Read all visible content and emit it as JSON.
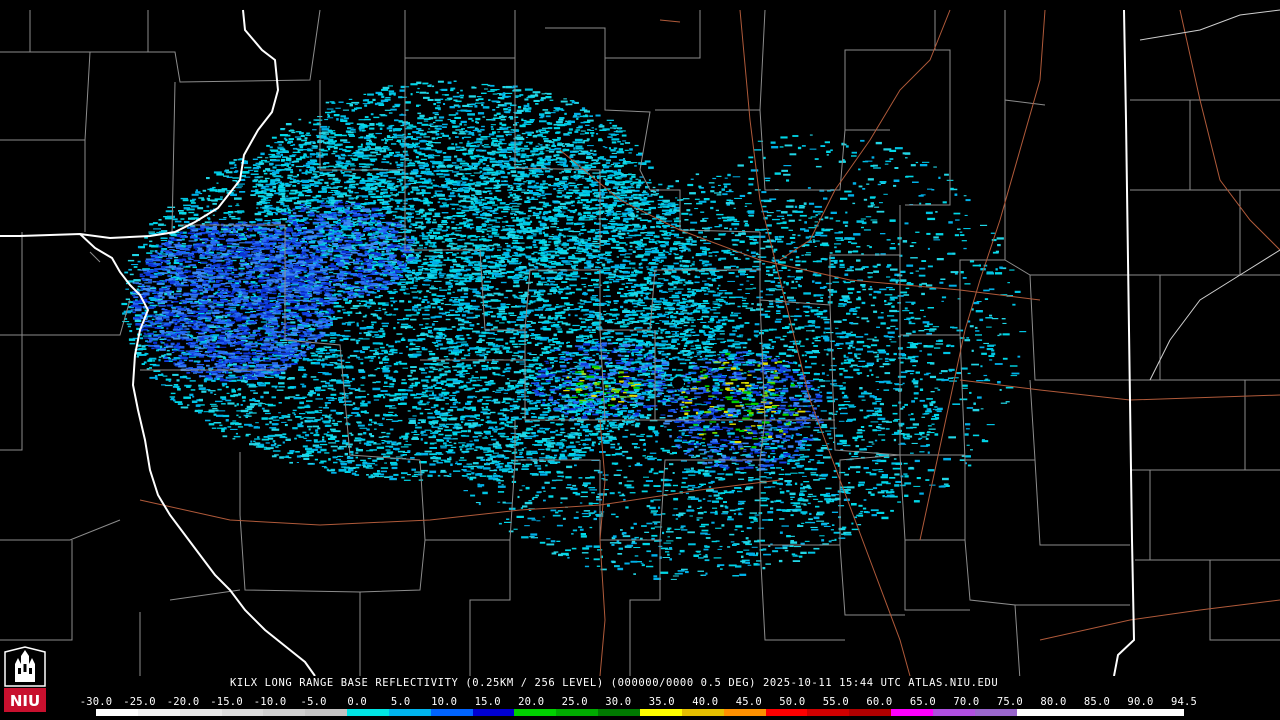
{
  "map": {
    "caption": "KILX LONG RANGE BASE REFLECTIVITY (0.25KM / 256 LEVEL) (000000/0000 0.5 DEG) 2025-10-11 15:44 UTC  ATLAS.NIU.EDU",
    "logo_text": "NIU",
    "colors": {
      "background": "#000000",
      "county_lines": "#8c8c8c",
      "state_lines": "#ffffff",
      "highways": "#b05a3a"
    }
  },
  "legend": {
    "labels": [
      "-30.0",
      "-25.0",
      "-20.0",
      "-15.0",
      "-10.0",
      "-5.0",
      "0.0",
      "5.0",
      "10.0",
      "15.0",
      "20.0",
      "25.0",
      "30.0",
      "35.0",
      "40.0",
      "45.0",
      "50.0",
      "55.0",
      "60.0",
      "65.0",
      "70.0",
      "75.0",
      "80.0",
      "85.0",
      "90.0",
      "94.5"
    ],
    "colors": [
      "#ffffff",
      "#f2f2f2",
      "#e6e6e6",
      "#dadada",
      "#cfcfcf",
      "#c4c4c4",
      "#00e5e5",
      "#00b4ee",
      "#0064ff",
      "#0000d0",
      "#00d000",
      "#00aa00",
      "#007a00",
      "#ffff00",
      "#e6c000",
      "#ff9000",
      "#ff0000",
      "#d00000",
      "#b00000",
      "#ff00ff",
      "#b050e0",
      "#9966cc",
      "#ffffff",
      "#ffffff",
      "#ffffff",
      "#ffffff"
    ]
  }
}
